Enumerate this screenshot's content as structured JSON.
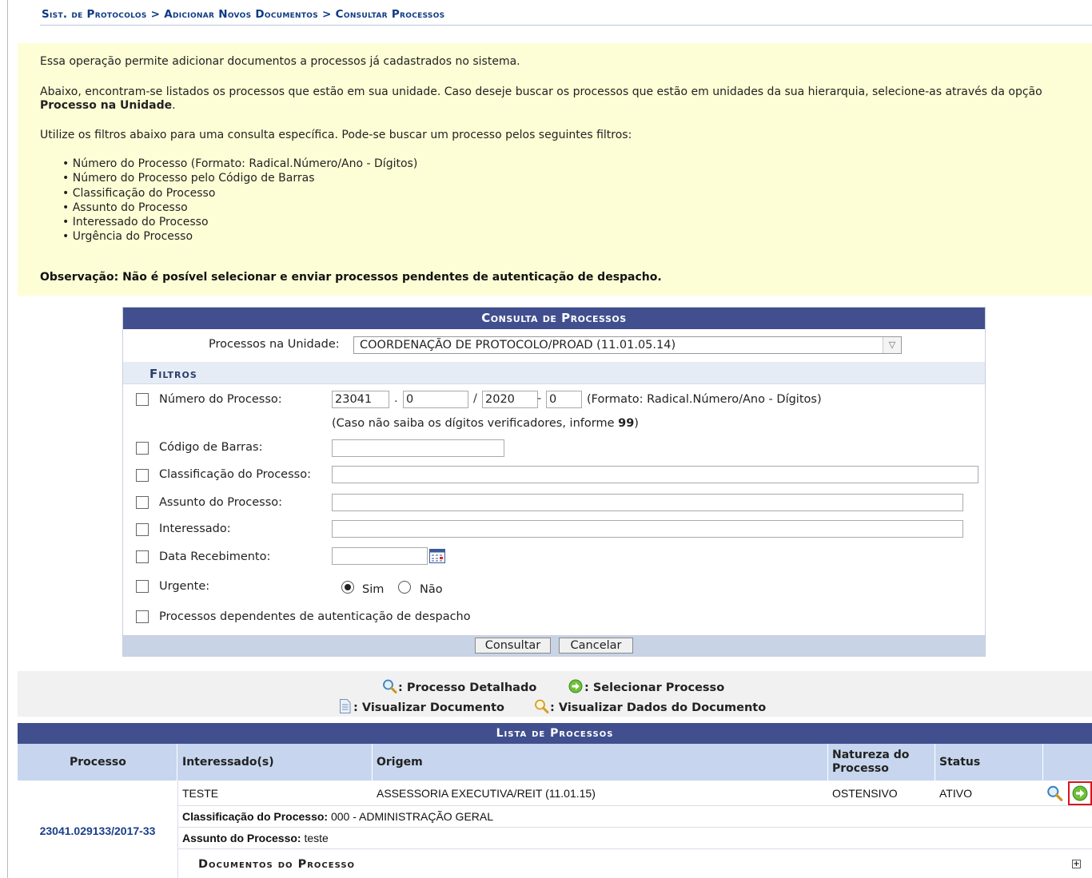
{
  "breadcrumb": "Sist. de Protocolos > Adicionar Novos Documentos > Consultar Processos",
  "info": {
    "p1": "Essa operação permite adicionar documentos a processos já cadastrados no sistema.",
    "p2_text": "Abaixo, encontram-se listados os processos que estão em sua unidade. Caso deseje buscar os processos que estão em unidades da sua hierarquia, selecione-as através da opção ",
    "p2_bold": "Processo na Unidade",
    "p3": "Utilize os filtros abaixo para uma consulta específica. Pode-se buscar um processo pelos seguintes filtros:",
    "filters": [
      "Número do Processo (Formato: Radical.Número/Ano - Dígitos)",
      "Número do Processo pelo Código de Barras",
      "Classificação do Processo",
      "Assunto do Processo",
      "Interessado do Processo",
      "Urgência do Processo"
    ],
    "obs": "Observação: Não é posível selecionar e enviar processos pendentes de autenticação de despacho."
  },
  "form": {
    "caption": "Consulta de Processos",
    "unit_label": "Processos na Unidade:",
    "unit_value": "COORDENAÇÃO DE PROTOCOLO/PROAD (11.01.05.14)",
    "filters_title": "Filtros",
    "numero_label": "Número do Processo:",
    "radical": "23041",
    "numero": "0",
    "ano": "2020",
    "digitos": "0",
    "format_hint": "(Formato: Radical.Número/Ano - Dígitos)",
    "digits_hint": "(Caso não saiba os dígitos verificadores, informe ",
    "digits_hint_bold": "99",
    "digits_hint_end": ")",
    "barcode_label": "Código de Barras:",
    "classificacao_label": "Classificação do Processo:",
    "assunto_label": "Assunto do Processo:",
    "interessado_label": "Interessado:",
    "data_label": "Data Recebimento:",
    "urgente_label": "Urgente:",
    "sim": "Sim",
    "nao": "Não",
    "dependentes_label": "Processos dependentes de autenticação de despacho",
    "consultar": "Consultar",
    "cancelar": "Cancelar"
  },
  "legend": {
    "detalhado": ": Processo Detalhado",
    "selecionar": ": Selecionar Processo",
    "visualizar_doc": ": Visualizar Documento",
    "visualizar_dados": ": Visualizar Dados do Documento"
  },
  "list": {
    "caption": "Lista de Processos",
    "headers": {
      "processo": "Processo",
      "interessados": "Interessado(s)",
      "origem": "Origem",
      "natureza_1": "Natureza do",
      "natureza_2": "Processo",
      "status": "Status"
    },
    "row": {
      "processo": "23041.029133/2017-33",
      "interessado": "TESTE",
      "origem": "ASSESSORIA EXECUTIVA/REIT (11.01.15)",
      "natureza": "OSTENSIVO",
      "status": "ATIVO",
      "classificacao_label": "Classificação do Processo:",
      "classificacao_value": "000 - ADMINISTRAÇÃO GERAL",
      "assunto_label": "Assunto do Processo:",
      "assunto_value": "teste",
      "docs_title": "Documentos do Processo"
    }
  },
  "icons": {
    "magnifier": "magnifier-icon",
    "select": "green-arrow-circle-icon",
    "document": "document-icon",
    "calendar": "calendar-icon",
    "expand": "plus-box-icon"
  },
  "colors": {
    "header_bar": "#414f8f",
    "info_bg": "#fefed6",
    "table_header": "#c7d6ee",
    "highlight": "#d8141c"
  }
}
